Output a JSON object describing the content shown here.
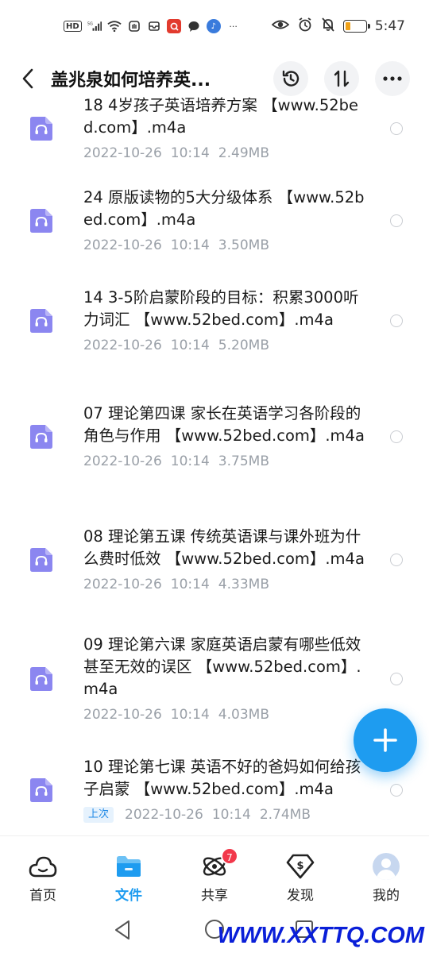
{
  "status_bar": {
    "left_indicators": [
      "HD",
      "5G"
    ],
    "time": "5:47",
    "battery_level": 0.25,
    "battery_color": "#f0a21a"
  },
  "header": {
    "title": "盖兆泉如何培养英...",
    "icons": [
      "back-arrow-icon",
      "history-clock-icon",
      "sort-icon",
      "more-icon"
    ]
  },
  "files": [
    {
      "name": "18 4岁孩子英语培养方案 【www.52bed.com】.m4a",
      "date": "2022-10-26",
      "time": "10:14",
      "size": "2.49MB",
      "badge": ""
    },
    {
      "name": "24 原版读物的5大分级体系 【www.52bed.com】.m4a",
      "date": "2022-10-26",
      "time": "10:14",
      "size": "3.50MB",
      "badge": ""
    },
    {
      "name": "14 3-5阶启蒙阶段的目标：积累3000听力词汇 【www.52bed.com】.m4a",
      "date": "2022-10-26",
      "time": "10:14",
      "size": "5.20MB",
      "badge": ""
    },
    {
      "name": "07 理论第四课 家长在英语学习各阶段的角色与作用 【www.52bed.com】.m4a",
      "date": "2022-10-26",
      "time": "10:14",
      "size": "3.75MB",
      "badge": ""
    },
    {
      "name": "08 理论第五课 传统英语课与课外班为什么费时低效 【www.52bed.com】.m4a",
      "date": "2022-10-26",
      "time": "10:14",
      "size": "4.33MB",
      "badge": ""
    },
    {
      "name": "09 理论第六课 家庭英语启蒙有哪些低效甚至无效的误区 【www.52bed.com】.m4a",
      "date": "2022-10-26",
      "time": "10:14",
      "size": "4.03MB",
      "badge": ""
    },
    {
      "name": "10 理论第七课 英语不好的爸妈如何给孩子启蒙 【www.52bed.com】.m4a",
      "date": "2022-10-26",
      "time": "10:14",
      "size": "2.74MB",
      "badge": "上次"
    }
  ],
  "tabs": [
    {
      "label": "首页",
      "icon": "cloud-home-icon",
      "active": false
    },
    {
      "label": "文件",
      "icon": "folder-icon",
      "active": true
    },
    {
      "label": "共享",
      "icon": "share-orbit-icon",
      "active": false,
      "badge": "7"
    },
    {
      "label": "发现",
      "icon": "discover-dollar-icon",
      "active": false
    },
    {
      "label": "我的",
      "icon": "avatar-icon",
      "active": false
    }
  ],
  "watermark": "WWW.XXTTQ.COM",
  "colors": {
    "accent": "#1e9cf0",
    "file_icon": "#8b86f0",
    "badge_red": "#f2384b"
  }
}
